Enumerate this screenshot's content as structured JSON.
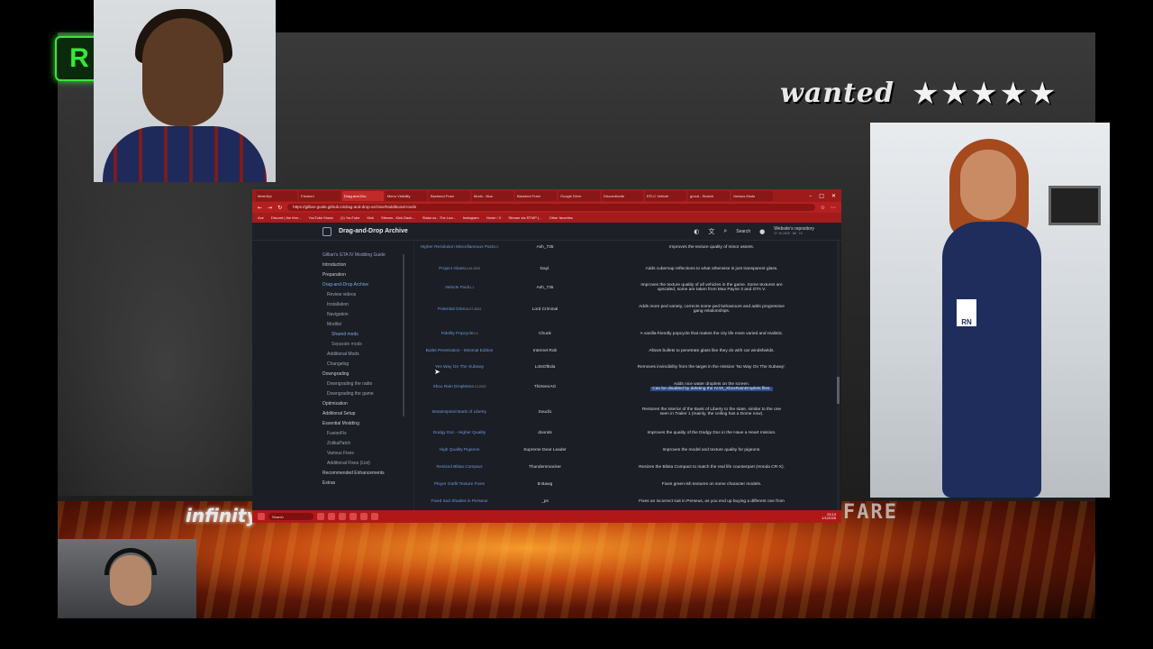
{
  "overlay": {
    "wanted_text": "wanted",
    "stars": "★★★★★",
    "infinity_text": "infinity",
    "fare_text": "FARE"
  },
  "browser": {
    "tabs": [
      {
        "label": "MeshSpi"
      },
      {
        "label": "Fandom"
      },
      {
        "label": "Drag-and-Dro"
      },
      {
        "label": "Menu Visibility"
      },
      {
        "label": "Backend Fram"
      },
      {
        "label": "Mods - Ittus"
      },
      {
        "label": "Backend Fram"
      },
      {
        "label": "Google Drive"
      },
      {
        "label": "DiscordInvite"
      },
      {
        "label": "EFLC Vehicle"
      },
      {
        "label": "gmod - Search"
      },
      {
        "label": "Various Mods"
      }
    ],
    "url": "https://gillian-guide.github.io/drag-and-drop-archive/#additional-mods",
    "bookmarks": [
      "Ave",
      "Discord | the free...",
      "YouTube Music",
      "(1) YouTube",
      "Kick",
      "Stream - Kick Dash...",
      "Stake.us - The Lea...",
      "Instagram",
      "Home / X",
      "Stream via RTMP (...",
      "Other favorites"
    ]
  },
  "site": {
    "title": "Drag-and-Drop Archive",
    "search_label": "Search",
    "repo_label": "Website's repository",
    "repo_meta": "27.10.2025 · 86 · 10"
  },
  "sidebar": {
    "items": [
      {
        "label": "Gillian's GTA IV Modding Guide",
        "level": "head"
      },
      {
        "label": "Introduction",
        "level": "l0"
      },
      {
        "label": "Preparation",
        "level": "l0"
      },
      {
        "label": "Drag-and-Drop Archive",
        "level": "active"
      },
      {
        "label": "Review videos",
        "level": "l1"
      },
      {
        "label": "Installation",
        "level": "l1"
      },
      {
        "label": "Navigation",
        "level": "l1"
      },
      {
        "label": "Modlist",
        "level": "l1"
      },
      {
        "label": "Shared mods",
        "level": "l2 active"
      },
      {
        "label": "Separate mods",
        "level": "l2"
      },
      {
        "label": "Additional Mods",
        "level": "l1"
      },
      {
        "label": "Changelog",
        "level": "l1"
      },
      {
        "label": "Downgrading",
        "level": "l0"
      },
      {
        "label": "Downgrading the radio",
        "level": "l1"
      },
      {
        "label": "Downgrading the game",
        "level": "l1"
      },
      {
        "label": "Optimization",
        "level": "l0"
      },
      {
        "label": "Additional Setup",
        "level": "l0"
      },
      {
        "label": "Essential Modding",
        "level": "l0"
      },
      {
        "label": "FusionFix",
        "level": "l1"
      },
      {
        "label": "ZolikaPatch",
        "level": "l1"
      },
      {
        "label": "Various Fixes",
        "level": "l1"
      },
      {
        "label": "Additional Fixes (List)",
        "level": "l1"
      },
      {
        "label": "Recommended Enhancements",
        "level": "l0"
      },
      {
        "label": "Extras",
        "level": "l0"
      }
    ]
  },
  "mods": [
    {
      "name": "Higher Resolution Miscellaneous Pack",
      "ver": "2.0",
      "author": "Ash_735",
      "desc": "Improves the texture quality of minor assets.",
      "desc2": ""
    },
    {
      "name": "Project Glass",
      "ver": "11.04.2023",
      "author": "Dayl.",
      "desc": "Adds cubemap reflections to what otherwise is just transparent glass.",
      "desc2": ""
    },
    {
      "name": "Vehicle Pack",
      "ver": "1.1",
      "author": "Ash_735",
      "desc": "Improves the texture quality of all vehicles in the game. Some textures are",
      "desc2": "upscaled, some are taken from Max Payne 3 and GTA V."
    },
    {
      "name": "Potential Grim",
      "ver": "15.07.2024",
      "author": "Lord Criminal",
      "desc": "Adds more ped variety, corrects some ped behaviours and adds progressive",
      "desc2": "gang relationships."
    },
    {
      "name": "Fidelity Popcycle",
      "ver": "1.0",
      "author": "Chunk",
      "desc": "A vanilla-friendly popcycle that makes the city life more varied and realistic.",
      "desc2": ""
    },
    {
      "name": "Bullet Penetration - Minimal Edition",
      "ver": "",
      "author": "Internet Rob",
      "desc": "Allows bullets to penetrate glass like they do with car windshields.",
      "desc2": ""
    },
    {
      "name": "Yes Way On The Subway",
      "ver": "",
      "author": "LotsOfEda",
      "desc": "Removes invincibility from the target in the mission 'No Way On The Subway'.",
      "desc2": ""
    },
    {
      "name": "Xbox Rain Droplets",
      "ver": "05.12.2023",
      "author": "ThirteenAG",
      "desc": "Adds nice water droplets on the screen.",
      "desc2": "Can be disabled by deleting the IV4X_XboxRainDroplets files."
    },
    {
      "name": "Betainspired Bank of Liberty",
      "ver": "",
      "author": "Soudi1",
      "desc": "Restores the interior of the Bank of Liberty to the state, similar to the one",
      "desc2": "seen in Trailer 1 (mainly, the ceiling has a Dome now)."
    },
    {
      "name": "Dodgy Doc - Higher Quality",
      "ver": "",
      "author": "doonits",
      "desc": "Improves the quality of the Dodgy Doc in the Have a Heart mission.",
      "desc2": ""
    },
    {
      "name": "High Quality Pigeons",
      "ver": "",
      "author": "Supreme Dear Leader",
      "desc": "Improves the model and texture quality for pigeons.",
      "desc2": ""
    },
    {
      "name": "Resized Blista Compact",
      "ver": "",
      "author": "Thundersmacker",
      "desc": "Resizes the Blista Compact to match the real life counterpart (Honda CR-X).",
      "desc2": ""
    },
    {
      "name": "Player Outfit Texture Fixes",
      "ver": "",
      "author": "B Bawg",
      "desc": "Fixes green-ish textures on some character models.",
      "desc2": ""
    },
    {
      "name": "Fixed Suit Shades in Perseus",
      "ver": "",
      "author": "_ps",
      "desc": "Fixes an incorrect suit in Perseus, as you end up buying a different one from",
      "desc2": ""
    }
  ],
  "taskbar": {
    "search_label": "Search",
    "time": "23:13",
    "date": "1/1/2026"
  }
}
